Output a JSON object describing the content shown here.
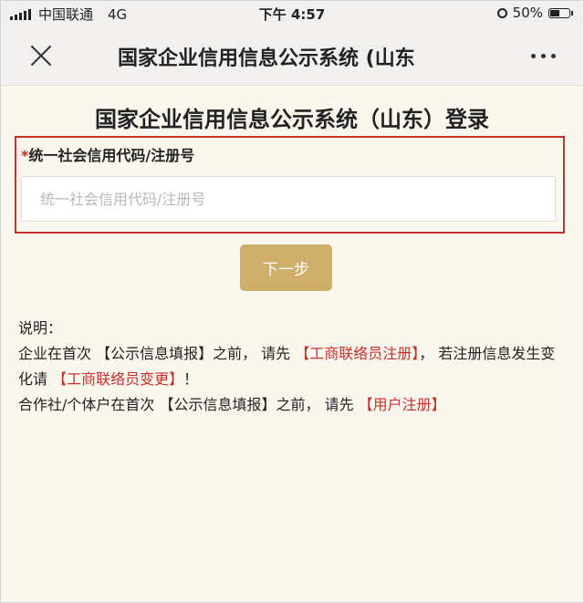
{
  "status_bar": {
    "carrier": "中国联通",
    "network": "4G",
    "time": "下午 4:57",
    "battery": "50%",
    "battery_level": 0.5
  },
  "nav": {
    "title": "国家企业信用信息公示系统 (山东",
    "close_icon": "close-icon",
    "more_icon": "more-dots-icon"
  },
  "page": {
    "title": "国家企业信用信息公示系统（山东）登录",
    "field": {
      "required_mark": "*",
      "label": "统一社会信用代码/注册号",
      "placeholder": "统一社会信用代码/注册号",
      "value": ""
    },
    "next_button": "下一步",
    "notes": {
      "heading": "说明：",
      "line1_a": "企业在首次 【公示信息填报】之前， 请先 ",
      "line1_link": "【工商联络员注册】",
      "line1_b": "， 若注册信息发生变化请 ",
      "line1_link2": "【工商联络员变更】",
      "line1_c": "！",
      "line2_a": "合作社/个体户在首次 【公示信息填报】之前， 请先 ",
      "line2_link": "【用户注册】"
    }
  },
  "colors": {
    "accent_red": "#c9302c",
    "button_gold": "#cfae6a",
    "page_bg": "#faf7ef"
  }
}
